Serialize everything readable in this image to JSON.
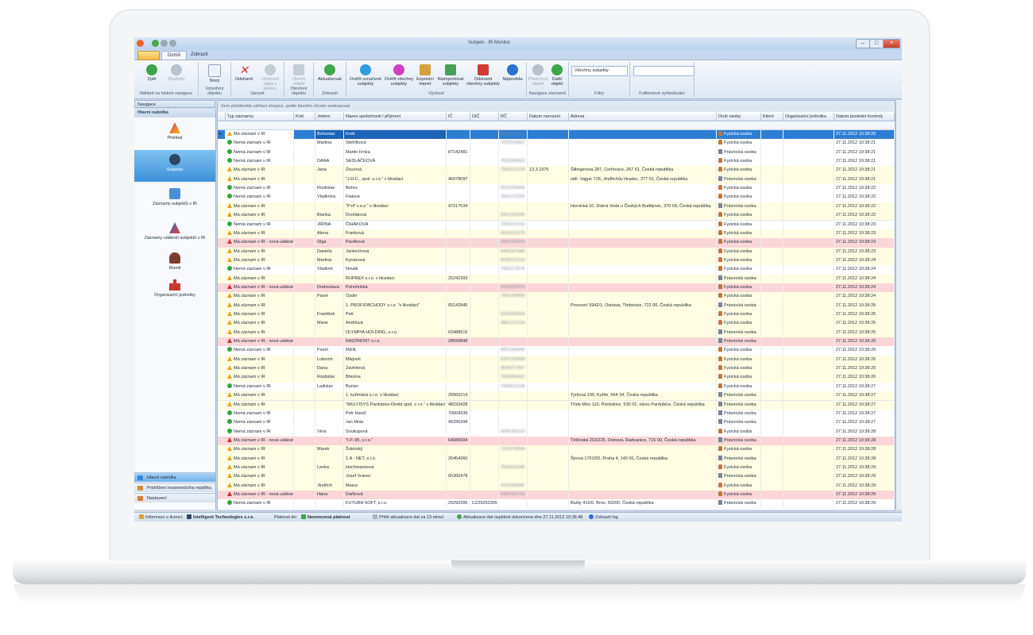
{
  "window": {
    "title": "Subjekt - IR Monitor"
  },
  "ribbon_tabs": [
    "Domů",
    "Zobrazit"
  ],
  "ribbon": {
    "back": "Zpět",
    "forward": "Dopředu",
    "new": "Nový",
    "delete": "Odstranit",
    "delete_from_watch": "Odstranit\nzápis z sledov.",
    "open": "Otevřít\nobjekt",
    "refresh": "Aktualizovat",
    "verify_marked": "Ověřit označené\nsubjekty",
    "verify_all": "Ověřit všechny\nsubjekty",
    "express_import": "Expresní\nimport",
    "import_subjects": "Naimportovat\nsubjekty",
    "remove_all": "Odstranit\nvšechny subjekty",
    "help": "Nápověda",
    "prev_obj": "Předchozí\nobjekt",
    "next_obj": "Další\nobjekt",
    "filter_value": "Všechny subjekty",
    "groups": [
      "Náhled na historii navigace",
      "Vytvoření objektu",
      "Upravit",
      "Otevření objektu",
      "Zobrazit",
      "Výchozí",
      "Navigace záznamů",
      "Filtry",
      "Fulltextové vyhledávání"
    ]
  },
  "nav": {
    "header": "Navigace",
    "title": "Hlavní nabídka",
    "items": [
      "Přehled",
      "Subjekty",
      "Záznamy subjektů v IR",
      "Záznamy událostí subjektů v IR",
      "Klienti",
      "Organizační jednotky"
    ],
    "bottom": [
      "Hlavní nabídka",
      "Prohlížení insolvenčního rejstříku",
      "Nastavení"
    ]
  },
  "grid": {
    "group_hint": "Sem přetáhněte záhlaví sloupce, podle kterého chcete seskupovat",
    "columns": [
      "Typ záznamu",
      "Kód",
      "Jméno",
      "Název společnosti / příjmení",
      "IČ",
      "DIČ",
      "RČ",
      "Datum narození",
      "Adresa",
      "Druh osoby",
      "Klient",
      "Organizační jednotka",
      "Datum poslední kontroly"
    ],
    "rows": [
      {
        "cls": "s",
        "st": "warn",
        "type": "Má záznam v IR",
        "name": "Bohuslav",
        "surname": "Krob",
        "ic": "",
        "dic": "",
        "rc": "6311131125",
        "birth": "",
        "addr": "",
        "kind": "Fyzická osoba",
        "date": "27.11.2012 10:38:20"
      },
      {
        "cls": "w",
        "st": "ok",
        "type": "Nemá záznam v IR",
        "name": "Martina",
        "surname": "Stehlíková",
        "ic": "",
        "dic": "",
        "rc": "7551524567",
        "birth": "",
        "addr": "",
        "kind": "Fyzická osoba",
        "date": "27.11.2012 10:38:21"
      },
      {
        "cls": "w",
        "st": "ok",
        "type": "Nemá záznam v IR",
        "name": "",
        "surname": "Martin Frnka",
        "ic": "87142481",
        "dic": "",
        "rc": "",
        "birth": "",
        "addr": "",
        "kind": "Právnická osoba",
        "date": "27.11.2012 10:38:21"
      },
      {
        "cls": "w",
        "st": "ok",
        "type": "Nemá záznam v IR",
        "name": "DANA",
        "surname": "SEDLÁČKOVÁ",
        "ic": "",
        "dic": "",
        "rc": "7652284522",
        "birth": "",
        "addr": "",
        "kind": "Fyzická osoba",
        "date": "27.11.2012 10:38:21"
      },
      {
        "cls": "y",
        "st": "warn",
        "type": "Má záznam v IR",
        "name": "Jana",
        "surname": "Žourová",
        "ic": "",
        "dic": "",
        "rc": "7553131234",
        "birth": "13.3.1975",
        "addr": "Šillingerova 287, Cerhovice, 267 61, Česká republika",
        "kind": "Fyzická osoba",
        "date": "27.11.2012 10:38:21"
      },
      {
        "cls": "y",
        "st": "warn",
        "type": "Má záznam v IR",
        "name": "",
        "surname": "\"J.H.C., spol. s.r.o.\" v likvidaci",
        "ic": "46978097",
        "dic": "",
        "rc": "",
        "birth": "",
        "addr": "sídl. Vajgar 728, Jindřichův Hradec, 377 01, Česká republika",
        "kind": "Právnická osoba",
        "date": "27.11.2012 10:38:21"
      },
      {
        "cls": "w",
        "st": "ok",
        "type": "Nemá záznam v IR",
        "name": "Rostislav",
        "surname": "Behro",
        "ic": "",
        "dic": "",
        "rc": "6512234455",
        "birth": "",
        "addr": "",
        "kind": "Fyzická osoba",
        "date": "27.11.2012 10:38:22"
      },
      {
        "cls": "w",
        "st": "ok",
        "type": "Nemá záznam v IR",
        "name": "Vladimíra",
        "surname": "Fialová",
        "ic": "",
        "dic": "",
        "rc": "7061122334",
        "birth": "",
        "addr": "",
        "kind": "Fyzická osoba",
        "date": "27.11.2012 10:38:22"
      },
      {
        "cls": "y",
        "st": "warn",
        "type": "Má záznam v IR",
        "name": "",
        "surname": "\"P+P v.o.s.\" v likvidaci",
        "ic": "47217634",
        "dic": "",
        "rc": "",
        "birth": "",
        "addr": "Hornická 10, Dobrá Voda u Českých Budějovic, 370 09, Česká republika",
        "kind": "Právnická osoba",
        "date": "27.11.2012 10:38:22"
      },
      {
        "cls": "y",
        "st": "warn",
        "type": "Má záznam v IR",
        "name": "Blanka",
        "surname": "Dvořáková",
        "ic": "",
        "dic": "",
        "rc": "6451092345",
        "birth": "",
        "addr": "",
        "kind": "Fyzická osoba",
        "date": "27.11.2012 10:38:22"
      },
      {
        "cls": "w",
        "st": "ok",
        "type": "Nemá záznam v IR",
        "name": "JIŘINA",
        "surname": "ČIHÁKOVÁ",
        "ic": "",
        "dic": "",
        "rc": "7260112233",
        "birth": "",
        "addr": "",
        "kind": "Fyzická osoba",
        "date": "27.11.2012 10:38:23"
      },
      {
        "cls": "y",
        "st": "warn",
        "type": "Má záznam v IR",
        "name": "Alena",
        "surname": "Franková",
        "ic": "",
        "dic": "",
        "rc": "6654122376",
        "birth": "",
        "addr": "",
        "kind": "Fyzická osoba",
        "date": "27.11.2012 10:38:23"
      },
      {
        "cls": "r",
        "st": "err",
        "type": "Má záznam v IR - nová událost",
        "name": "Olga",
        "surname": "Pavlíková",
        "ic": "",
        "dic": "",
        "rc": "5862284324",
        "birth": "",
        "addr": "",
        "kind": "Fyzická osoba",
        "date": "27.11.2012 10:38:23"
      },
      {
        "cls": "y",
        "st": "warn",
        "type": "Má záznam v IR",
        "name": "Daniela",
        "surname": "Jankechová",
        "ic": "",
        "dic": "",
        "rc": "6452257689",
        "birth": "",
        "addr": "",
        "kind": "Fyzická osoba",
        "date": "27.11.2012 10:38:23"
      },
      {
        "cls": "y",
        "st": "warn",
        "type": "Má záznam v IR",
        "name": "Martina",
        "surname": "Kyrianová",
        "ic": "",
        "dic": "",
        "rc": "6655310123",
        "birth": "",
        "addr": "",
        "kind": "Fyzická osoba",
        "date": "27.11.2012 10:38:24"
      },
      {
        "cls": "w",
        "st": "ok",
        "type": "Nemá záznam v IR",
        "name": "Vladimír",
        "surname": "Novák",
        "ic": "",
        "dic": "",
        "rc": "7402272575",
        "birth": "",
        "addr": "",
        "kind": "Fyzická osoba",
        "date": "27.11.2012 10:38:24"
      },
      {
        "cls": "y",
        "st": "warn",
        "type": "Má záznam v IR",
        "name": "",
        "surname": "RUPREX s.r.o. v likvidaci",
        "ic": "25242393",
        "dic": "",
        "rc": "",
        "birth": "",
        "addr": "",
        "kind": "Právnická osoba",
        "date": "27.11.2012 10:38:24"
      },
      {
        "cls": "r",
        "st": "err",
        "type": "Má záznam v IR - nová událost",
        "name": "Drahoslava",
        "surname": "Pohořelská",
        "ic": "",
        "dic": "",
        "rc": "4956283424",
        "birth": "",
        "addr": "",
        "kind": "Fyzická osoba",
        "date": "27.11.2012 10:38:24"
      },
      {
        "cls": "y",
        "st": "warn",
        "type": "Má záznam v IR",
        "name": "Pavel",
        "surname": "Ozdin",
        "ic": "",
        "dic": "",
        "rc": "7401249558",
        "birth": "",
        "addr": "",
        "kind": "Fyzická osoba",
        "date": "27.11.2012 10:38:24"
      },
      {
        "cls": "y",
        "st": "warn",
        "type": "Má záznam v IR",
        "name": "",
        "surname": "1. PROFIOBCHODY s.r.o. \"v likvidaci\"",
        "ic": "65142845",
        "dic": "",
        "rc": "",
        "birth": "",
        "addr": "Provozní 5942/1, Ostrava, Třebovice, 722 00, Česká republika",
        "kind": "Právnická osoba",
        "date": "27.11.2012 10:38:25"
      },
      {
        "cls": "y",
        "st": "warn",
        "type": "Má záznam v IR",
        "name": "František",
        "surname": "Petr",
        "ic": "",
        "dic": "",
        "rc": "5204282434",
        "birth": "",
        "addr": "",
        "kind": "Fyzická osoba",
        "date": "27.11.2012 10:38:25"
      },
      {
        "cls": "y",
        "st": "warn",
        "type": "Má záznam v IR",
        "name": "Marie",
        "surname": "Andrlová",
        "ic": "",
        "dic": "",
        "rc": "4862101234",
        "birth": "",
        "addr": "",
        "kind": "Fyzická osoba",
        "date": "27.11.2012 10:38:25"
      },
      {
        "cls": "y",
        "st": "warn",
        "type": "Má záznam v IR",
        "name": "",
        "surname": "OLYMPIA HOLDING, s.r.o.",
        "ic": "63488515",
        "dic": "",
        "rc": "",
        "birth": "",
        "addr": "",
        "kind": "Právnická osoba",
        "date": "27.11.2012 10:38:25"
      },
      {
        "cls": "r",
        "st": "err",
        "type": "Má záznam v IR - nová událost",
        "name": "",
        "surname": "RAZZMONT s.r.o.",
        "ic": "28590848",
        "dic": "",
        "rc": "",
        "birth": "",
        "addr": "",
        "kind": "Právnická osoba",
        "date": "27.11.2012 10:38:25"
      },
      {
        "cls": "w",
        "st": "ok",
        "type": "Nemá záznam v IR",
        "name": "Pavel",
        "surname": "Mičík",
        "ic": "",
        "dic": "",
        "rc": "6501243456",
        "birth": "",
        "addr": "",
        "kind": "Fyzická osoba",
        "date": "27.11.2012 10:38:26"
      },
      {
        "cls": "y",
        "st": "warn",
        "type": "Má záznam v IR",
        "name": "Lubomír",
        "surname": "Mlejnek",
        "ic": "",
        "dic": "",
        "rc": "6307220098",
        "birth": "",
        "addr": "",
        "kind": "Fyzická osoba",
        "date": "27.11.2012 10:38:26"
      },
      {
        "cls": "y",
        "st": "warn",
        "type": "Má záznam v IR",
        "name": "Dana",
        "surname": "Zavřelová",
        "ic": "",
        "dic": "",
        "rc": "4558271467",
        "birth": "",
        "addr": "",
        "kind": "Fyzická osoba",
        "date": "27.11.2012 10:38:26"
      },
      {
        "cls": "y",
        "st": "warn",
        "type": "Má záznam v IR",
        "name": "Rostislav",
        "surname": "Březina",
        "ic": "",
        "dic": "",
        "rc": "7009094422",
        "birth": "",
        "addr": "",
        "kind": "Fyzická osoba",
        "date": "27.11.2012 10:38:26"
      },
      {
        "cls": "w",
        "st": "ok",
        "type": "Nemá záznam v IR",
        "name": "Ladislav",
        "surname": "Burian",
        "ic": "",
        "dic": "",
        "rc": "7408031234",
        "birth": "",
        "addr": "",
        "kind": "Fyzická osoba",
        "date": "27.11.2012 10:38:27"
      },
      {
        "cls": "y",
        "st": "warn",
        "type": "Má záznam v IR",
        "name": "",
        "surname": "1. kuřimská s.r.o. v likvidaci",
        "ic": "25565214",
        "dic": "",
        "rc": "",
        "birth": "",
        "addr": "Tyršova 190, Kuřim, 664 34, Česká republika",
        "kind": "Právnická osoba",
        "date": "27.11.2012 10:38:27"
      },
      {
        "cls": "y",
        "st": "warn",
        "type": "Má záznam v IR",
        "name": "",
        "surname": "\"MULTISYS Pardubice-Direkt spol. s r.o.\" v likvidaci",
        "ic": "48150428",
        "dic": "",
        "rc": "",
        "birth": "",
        "addr": "Třída Míru 110, Pardubice, 530 02, okres Pardubice, Česká republika",
        "kind": "Právnická osoba",
        "date": "27.11.2012 10:38:27"
      },
      {
        "cls": "w",
        "st": "ok",
        "type": "Nemá záznam v IR",
        "name": "",
        "surname": "Petr Hanžl",
        "ic": "70604339",
        "dic": "",
        "rc": "",
        "birth": "",
        "addr": "",
        "kind": "Právnická osoba",
        "date": "27.11.2012 10:38:27"
      },
      {
        "cls": "w",
        "st": "ok",
        "type": "Nemá záznam v IR",
        "name": "",
        "surname": "Jan Mráz",
        "ic": "49336398",
        "dic": "",
        "rc": "",
        "birth": "",
        "addr": "",
        "kind": "Právnická osoba",
        "date": "27.11.2012 10:38:27"
      },
      {
        "cls": "w",
        "st": "ok",
        "type": "Nemá záznam v IR",
        "name": "Věra",
        "surname": "Soukupová",
        "ic": "",
        "dic": "",
        "rc": "4256181223",
        "birth": "",
        "addr": "",
        "kind": "Fyzická osoba",
        "date": "27.11.2012 10:38:28"
      },
      {
        "cls": "r",
        "st": "err",
        "type": "Má záznam v IR - nová událost",
        "name": "",
        "surname": "\"I.P.-95, s.r.o.\"",
        "ic": "64085694",
        "dic": "",
        "rc": "",
        "birth": "",
        "addr": "Těšínská 202/225, Ostrava, Radvanice, 716 00, Česká republika",
        "kind": "Právnická osoba",
        "date": "27.11.2012 10:38:28"
      },
      {
        "cls": "y",
        "st": "warn",
        "type": "Má záznam v IR",
        "name": "Marek",
        "surname": "Šrámský",
        "ic": "",
        "dic": "",
        "rc": "7310279534",
        "birth": "",
        "addr": "",
        "kind": "Fyzická osoba",
        "date": "27.11.2012 10:38:28"
      },
      {
        "cls": "y",
        "st": "warn",
        "type": "Má záznam v IR",
        "name": "",
        "surname": "1.A - NET, s.r.o.",
        "ic": "26454360",
        "dic": "",
        "rc": "",
        "birth": "",
        "addr": "Štrova 1701/55, Praha 4, 140 00, Česká republika",
        "kind": "Právnická osoba",
        "date": "27.11.2012 10:38:28"
      },
      {
        "cls": "y",
        "st": "warn",
        "type": "Má záznam v IR",
        "name": "Lenka",
        "surname": "Hochmannová",
        "ic": "",
        "dic": "",
        "rc": "7656232345",
        "birth": "",
        "addr": "",
        "kind": "Fyzická osoba",
        "date": "27.11.2012 10:38:29"
      },
      {
        "cls": "y",
        "st": "warn",
        "type": "Má záznam v IR",
        "name": "",
        "surname": "Josef Vranec",
        "ic": "65360478",
        "dic": "",
        "rc": "",
        "birth": "",
        "addr": "",
        "kind": "Právnická osoba",
        "date": "27.11.2012 10:38:29"
      },
      {
        "cls": "y",
        "st": "warn",
        "type": "Má záznam v IR",
        "name": "Jindřich",
        "surname": "Mazur",
        "ic": "",
        "dic": "",
        "rc": "4111256486",
        "birth": "",
        "addr": "",
        "kind": "Fyzická osoba",
        "date": "27.11.2012 10:38:29"
      },
      {
        "cls": "r",
        "st": "err",
        "type": "Má záznam v IR - nová událost",
        "name": "Hana",
        "surname": "Daňková",
        "ic": "",
        "dic": "",
        "rc": "6362285742",
        "birth": "",
        "addr": "",
        "kind": "Fyzická osoba",
        "date": "27.11.2012 10:38:29"
      },
      {
        "cls": "w",
        "st": "ok",
        "type": "Nemá záznam v IR",
        "name": "",
        "surname": "FUTURA SOFT, s.r.o.",
        "ic": "29292395",
        "dic": "CZ29292395",
        "rc": "",
        "birth": "",
        "addr": "Bašty 415/6, Brno, 60200, Česká republika",
        "kind": "Právnická osoba",
        "date": "27.11.2012 10:38:29"
      }
    ]
  },
  "status": {
    "license_label": "Informace o licenci:",
    "company": "Intelligent Technologies s.r.o.",
    "valid_label": "Platnost do:",
    "valid_value": "Neomezená platnost",
    "next_update": "Příští aktualizace dat za 13 minut",
    "last_update": "Aktualizace dat úspěšně dokončena dne 27.11.2012 10:36:48",
    "show_log": "Zobrazit log"
  },
  "colors": {
    "selected": "#2e7fd3",
    "has_record": "#fffde3",
    "new_event": "#fbd6d9"
  }
}
